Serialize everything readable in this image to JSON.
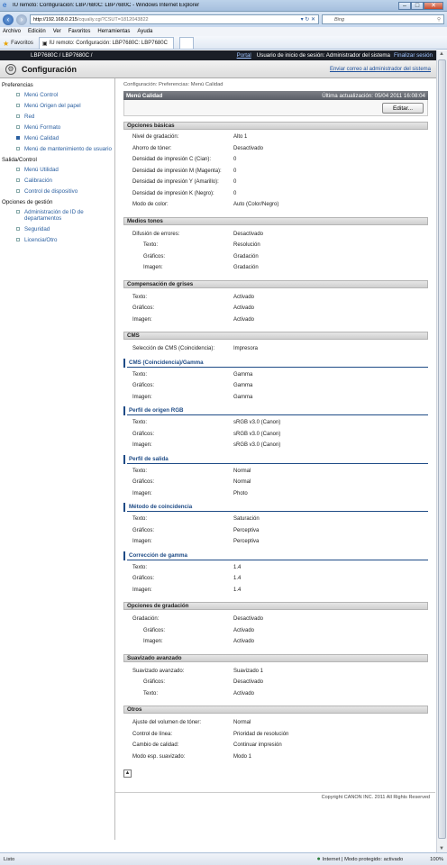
{
  "window": {
    "title": "IU remoto: Configuración: LBP7680C: LBP7680C - Windows Internet Explorer"
  },
  "address": {
    "host": "http://192.168.0.215",
    "rest": "/cqualiy.cgi?CSUT=1812043822",
    "search_placeholder": "Bing"
  },
  "menu": [
    "Archivo",
    "Edición",
    "Ver",
    "Favoritos",
    "Herramientas",
    "Ayuda"
  ],
  "favorites": {
    "label": "Favoritos",
    "tab_title": "IU remoto: Configuración: LBP7680C: LBP7680C"
  },
  "topband": {
    "device": "LBP7680C / LBP7680C /",
    "portal": "Portal",
    "user": "Usuario de inicio de sesión: Administrador del sistema",
    "logout": "Finalizar sesión"
  },
  "header": {
    "title": "Configuración",
    "mail": "Enviar correo al administrador del sistema"
  },
  "sidebar": {
    "g1": "Preferencias",
    "g1_items": [
      "Menú Control",
      "Menú Origen del papel",
      "Red",
      "Menú Formato",
      "Menú Calidad",
      "Menú de mantenimiento de usuario"
    ],
    "g2": "Salida/Control",
    "g2_items": [
      "Menú Utilidad",
      "Calibración",
      "Control de dispositivo"
    ],
    "g3": "Opciones de gestión",
    "g3_items": [
      "Administración de ID de departamentos",
      "Seguridad",
      "Licencia/Otro"
    ]
  },
  "main": {
    "breadcrumb": "Configuración: Preferencias: Menú Calidad",
    "section_title": "Menú Calidad",
    "last_update": "Última actualización: 05/04 2011 16:08:04",
    "edit_label": "Editar...",
    "basic": {
      "title": "Opciones básicas",
      "rows": [
        [
          "Nivel de gradación:",
          "Alto 1"
        ],
        [
          "Ahorro de tóner:",
          "Desactivado"
        ],
        [
          "Densidad de impresión C (Cian):",
          "0"
        ],
        [
          "Densidad de impresión M (Magenta):",
          "0"
        ],
        [
          "Densidad de impresión Y (Amarillo):",
          "0"
        ],
        [
          "Densidad de impresión K (Negro):",
          "0"
        ],
        [
          "Modo de color:",
          "Auto (Color/Negro)"
        ]
      ]
    },
    "halftone": {
      "title": "Medios tonos",
      "rows": [
        [
          "Difusión de errores:",
          "Desactivado"
        ],
        [
          "Texto:",
          "Resolución"
        ],
        [
          "Gráficos:",
          "Gradación"
        ],
        [
          "Imagen:",
          "Gradación"
        ]
      ]
    },
    "gray": {
      "title": "Compensación de grises",
      "rows": [
        [
          "Texto:",
          "Activado"
        ],
        [
          "Gráficos:",
          "Activado"
        ],
        [
          "Imagen:",
          "Activado"
        ]
      ]
    },
    "cms": {
      "title": "CMS",
      "selection": [
        "Selección de CMS (Coincidencia):",
        "Impresora"
      ],
      "gamma_title": "CMS (Coincidencia)/Gamma",
      "gamma_rows": [
        [
          "Texto:",
          "Gamma"
        ],
        [
          "Gráficos:",
          "Gamma"
        ],
        [
          "Imagen:",
          "Gamma"
        ]
      ],
      "rgb_title": "Perfil de origen RGB",
      "rgb_rows": [
        [
          "Texto:",
          "sRGB v3.0 (Canon)"
        ],
        [
          "Gráficos:",
          "sRGB v3.0 (Canon)"
        ],
        [
          "Imagen:",
          "sRGB v3.0 (Canon)"
        ]
      ],
      "out_title": "Perfil de salida",
      "out_rows": [
        [
          "Texto:",
          "Normal"
        ],
        [
          "Gráficos:",
          "Normal"
        ],
        [
          "Imagen:",
          "Photo"
        ]
      ],
      "match_title": "Método de coincidencia",
      "match_rows": [
        [
          "Texto:",
          "Saturación"
        ],
        [
          "Gráficos:",
          "Perceptiva"
        ],
        [
          "Imagen:",
          "Perceptiva"
        ]
      ],
      "corr_title": "Corrección de gamma",
      "corr_rows": [
        [
          "Texto:",
          "1.4"
        ],
        [
          "Gráficos:",
          "1.4"
        ],
        [
          "Imagen:",
          "1.4"
        ]
      ]
    },
    "gradation": {
      "title": "Opciones de gradación",
      "rows": [
        [
          "Gradación:",
          "Desactivado"
        ],
        [
          "Gráficos:",
          "Activado"
        ],
        [
          "Imagen:",
          "Activado"
        ]
      ]
    },
    "smooth": {
      "title": "Suavizado avanzado",
      "rows": [
        [
          "Suavizado avanzado:",
          "Suavizado 1"
        ],
        [
          "Gráficos:",
          "Desactivado"
        ],
        [
          "Texto:",
          "Activado"
        ]
      ]
    },
    "other": {
      "title": "Otros",
      "rows": [
        [
          "Ajuste del volumen de tóner:",
          "Normal"
        ],
        [
          "Control de línea:",
          "Prioridad de resolución"
        ],
        [
          "Cambio de calidad:",
          "Continuar impresión"
        ],
        [
          "Modo esp. suavizado:",
          "Modo 1"
        ]
      ]
    }
  },
  "footer": {
    "copyright": "Copyright CANON INC. 2011 All Rights Reserved"
  },
  "status": {
    "ready": "Listo",
    "zone": "Internet | Modo protegido: activado",
    "zoom": "100%"
  }
}
